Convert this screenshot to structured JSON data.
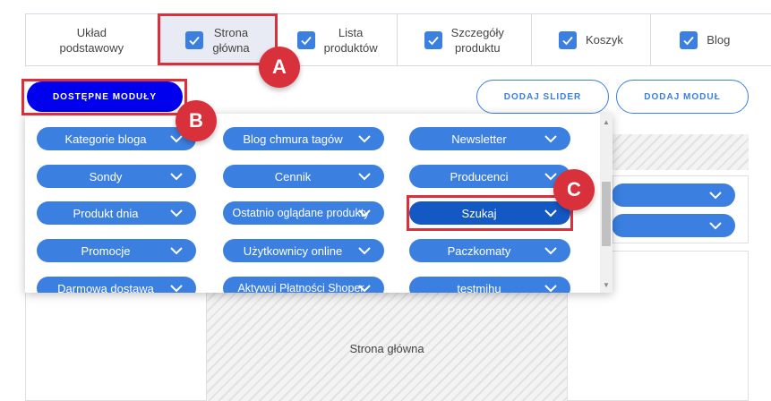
{
  "tabs": [
    {
      "label": "Układ\npodstawowy",
      "checked": false,
      "active": false
    },
    {
      "label": "Strona\ngłówna",
      "checked": true,
      "active": true
    },
    {
      "label": "Lista\nproduktów",
      "checked": true,
      "active": false
    },
    {
      "label": "Szczegóły\nproduktu",
      "checked": true,
      "active": false
    },
    {
      "label": "Koszyk",
      "checked": true,
      "active": false
    },
    {
      "label": "Blog",
      "checked": true,
      "active": false
    }
  ],
  "buttons": {
    "available_modules": "DOSTĘPNE MODUŁY",
    "add_slider": "DODAJ SLIDER",
    "add_module": "DODAJ MODUŁ"
  },
  "modules": [
    [
      "Kategorie bloga",
      "Blog chmura tagów",
      "Newsletter"
    ],
    [
      "Sondy",
      "Cennik",
      "Producenci"
    ],
    [
      "Produkt dnia",
      "Ostatnio oglądane produkty",
      "Szukaj"
    ],
    [
      "Promocje",
      "Użytkownicy online",
      "Paczkomaty"
    ],
    [
      "Darmowa dostawa",
      "Aktywuj Płatności Shoper",
      "testmihu"
    ]
  ],
  "selected_module": "Szukaj",
  "annotations": {
    "a": "A",
    "b": "B",
    "c": "C"
  },
  "page_area_label": "Strona główna",
  "colors": {
    "accent": "#3b7fe0",
    "primary_button": "#0000ee",
    "annotation": "#d9313b",
    "selected_pill": "#1458c4"
  }
}
